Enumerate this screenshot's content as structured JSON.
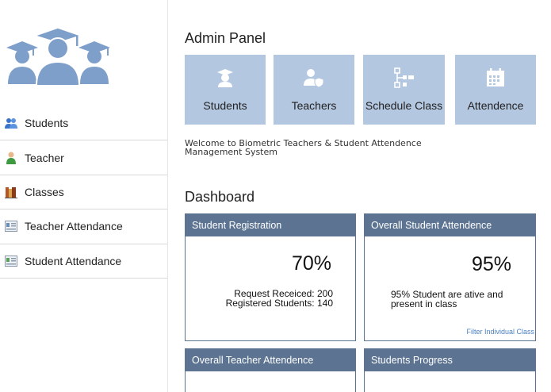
{
  "sidebar": {
    "items": [
      {
        "label": "Students",
        "icon": "students-icon"
      },
      {
        "label": "Teacher",
        "icon": "teacher-icon"
      },
      {
        "label": "Classes",
        "icon": "books-icon"
      },
      {
        "label": "Teacher Attendance",
        "icon": "attendance-card-icon"
      },
      {
        "label": "Student Attendance",
        "icon": "attendance-card-icon"
      }
    ]
  },
  "admin": {
    "title": "Admin Panel",
    "tiles": [
      {
        "label": "Students",
        "icon": "graduate-icon"
      },
      {
        "label": "Teachers",
        "icon": "teacher-shield-icon"
      },
      {
        "label": "Schedule Class",
        "icon": "schedule-tree-icon"
      },
      {
        "label": "Attendence",
        "icon": "calendar-icon"
      }
    ],
    "welcome": "Welcome to Biometric Teachers & Student Attendence Management System"
  },
  "dashboard": {
    "title": "Dashboard",
    "panels": {
      "registration": {
        "title": "Student Registration",
        "percent": "70%",
        "line1": "Request Receiced: 200",
        "line2": "Registered Students: 140"
      },
      "student_attendance": {
        "title": "Overall Student Attendence",
        "percent": "95%",
        "line1": "95% Student are ative and",
        "line2": "present in class",
        "link": "Filter Individual Class"
      },
      "teacher_attendance": {
        "title": "Overall Teacher Attendence"
      },
      "progress": {
        "title": "Students Progress"
      }
    }
  },
  "colors": {
    "tile_bg": "#b3c7e1",
    "panel_header": "#5c7492",
    "logo_blue": "#7f9fcb",
    "link": "#4a7fc1"
  }
}
